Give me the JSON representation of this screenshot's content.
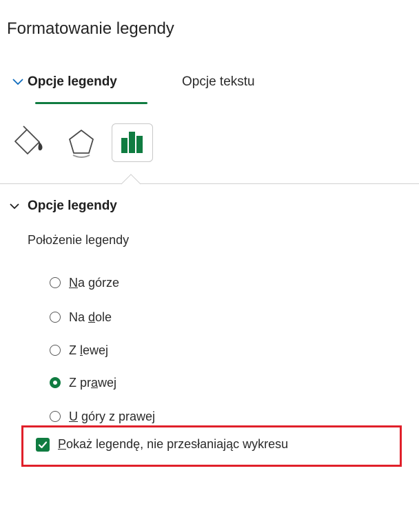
{
  "pane": {
    "title": "Formatowanie legendy"
  },
  "tabs": [
    {
      "label": "Opcje legendy",
      "selected": true,
      "icon": "chevron-down-icon"
    },
    {
      "label": "Opcje tekstu",
      "selected": false
    }
  ],
  "icon_row": [
    {
      "name": "fill-line-icon",
      "selected": false
    },
    {
      "name": "effects-pentagon-icon",
      "selected": false
    },
    {
      "name": "legend-options-bar-chart-icon",
      "selected": true
    }
  ],
  "section": {
    "title": "Opcje legendy",
    "expanded": true,
    "position_label": "Położenie legendy",
    "radio_options": [
      {
        "pre": "",
        "accel": "N",
        "post": "a górze",
        "checked": false
      },
      {
        "pre": "Na ",
        "accel": "d",
        "post": "ole",
        "checked": false
      },
      {
        "pre": "Z ",
        "accel": "l",
        "post": "ewej",
        "checked": false
      },
      {
        "pre": "Z pr",
        "accel": "a",
        "post": "wej",
        "checked": true
      },
      {
        "pre": "",
        "accel": "U",
        "post": " góry z prawej",
        "checked": false
      }
    ],
    "checkbox": {
      "accel": "P",
      "post": "okaż legendę, nie przesłaniając wykresu",
      "checked": true
    }
  },
  "colors": {
    "accent": "#107c41",
    "highlight": "#e0202a",
    "chevron": "#0f6cbd"
  }
}
